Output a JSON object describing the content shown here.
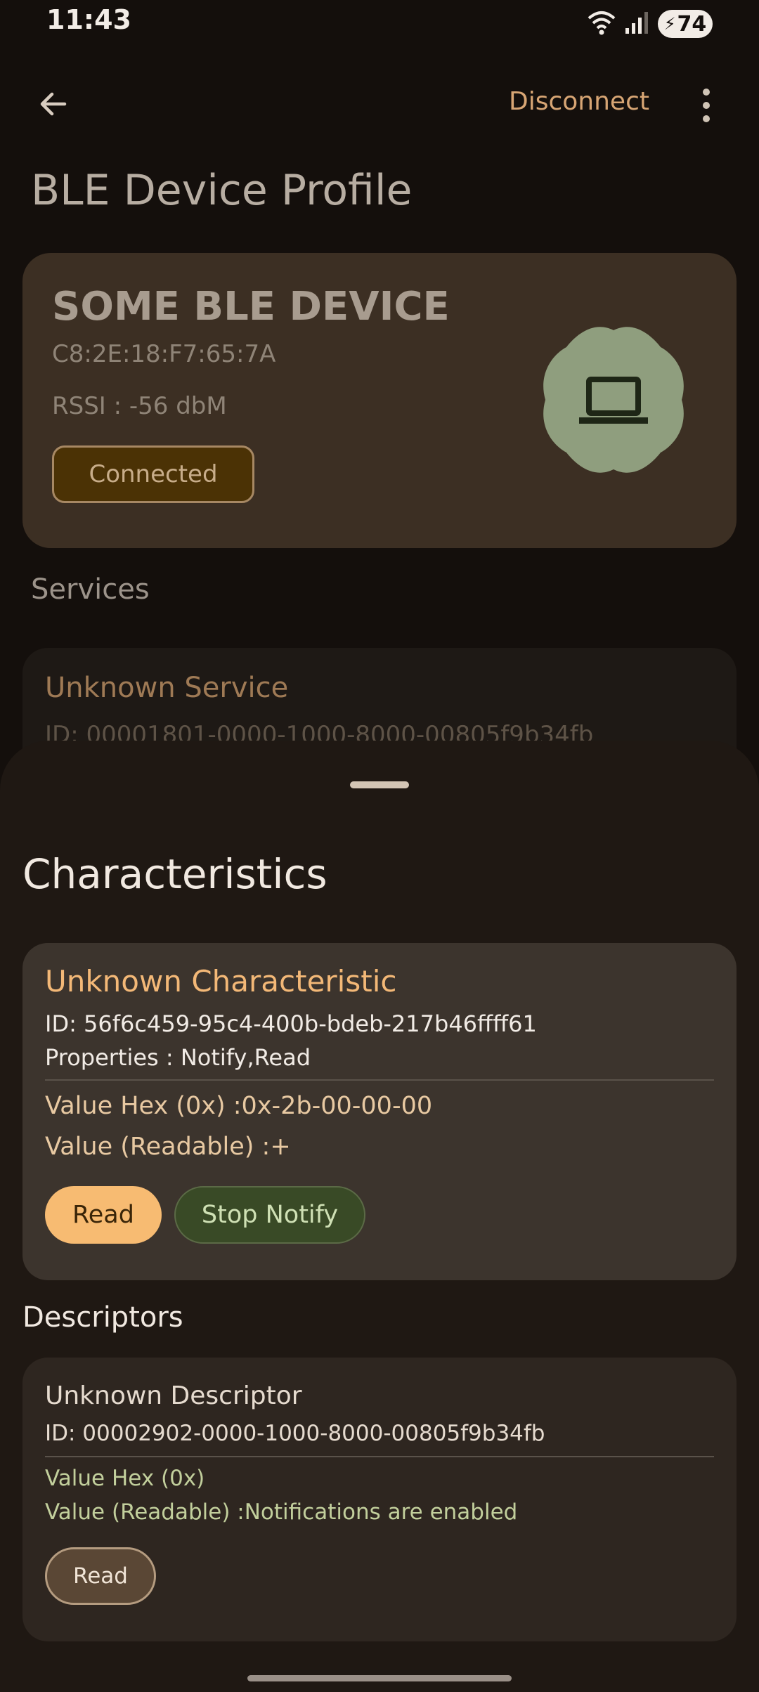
{
  "status_bar": {
    "time": "11:43",
    "battery": "74"
  },
  "top_bar": {
    "action": "Disconnect",
    "title": "BLE Device Profile"
  },
  "device": {
    "name": "SOME BLE DEVICE",
    "mac": "C8:2E:18:F7:65:7A",
    "rssi": "RSSI : -56 dbM",
    "status": "Connected",
    "icon": "laptop-icon"
  },
  "services": {
    "label": "Services",
    "items": [
      {
        "name": "Unknown Service",
        "id": "ID: 00001801-0000-1000-8000-00805f9b34fb"
      }
    ]
  },
  "sheet": {
    "title": "Characteristics",
    "characteristic": {
      "name": "Unknown Characteristic",
      "id": "ID: 56f6c459-95c4-400b-bdeb-217b46ffff61",
      "properties": "Properties : Notify,Read",
      "value_hex": "Value Hex (0x) :0x-2b-00-00-00",
      "value_readable": "Value (Readable) :+",
      "read_label": "Read",
      "notify_label": "Stop Notify"
    },
    "descriptors_label": "Descriptors",
    "descriptor": {
      "name": "Unknown Descriptor",
      "id": "ID: 00002902-0000-1000-8000-00805f9b34fb",
      "value_hex": "Value Hex (0x)",
      "value_readable": "Value (Readable) :Notifications are enabled",
      "read_label": "Read"
    }
  },
  "colors": {
    "accent": "#f7bb72",
    "card": "#3c2f23",
    "sheet": "#1f1813"
  }
}
